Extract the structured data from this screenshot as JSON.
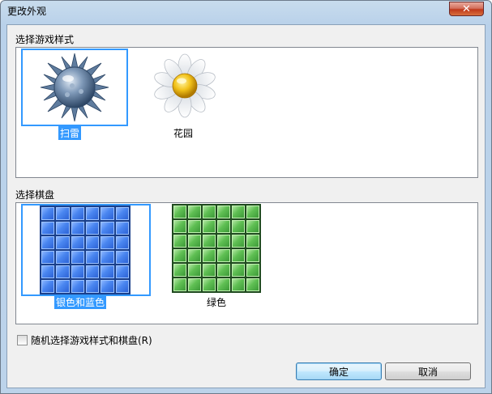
{
  "window": {
    "title": "更改外观",
    "close_label": "✕"
  },
  "game_style": {
    "label": "选择游戏样式",
    "items": [
      {
        "label": "扫雷",
        "icon": "mine-icon",
        "selected": true
      },
      {
        "label": "花园",
        "icon": "flower-icon",
        "selected": false
      }
    ]
  },
  "board": {
    "label": "选择棋盘",
    "items": [
      {
        "label": "银色和蓝色",
        "icon": "blue-board-icon",
        "selected": true,
        "color": "#2c63d6"
      },
      {
        "label": "绿色",
        "icon": "green-board-icon",
        "selected": false,
        "color": "#3d9a38"
      }
    ]
  },
  "random": {
    "label": "随机选择游戏样式和棋盘(R)",
    "checked": false
  },
  "buttons": {
    "ok": "确定",
    "cancel": "取消"
  }
}
